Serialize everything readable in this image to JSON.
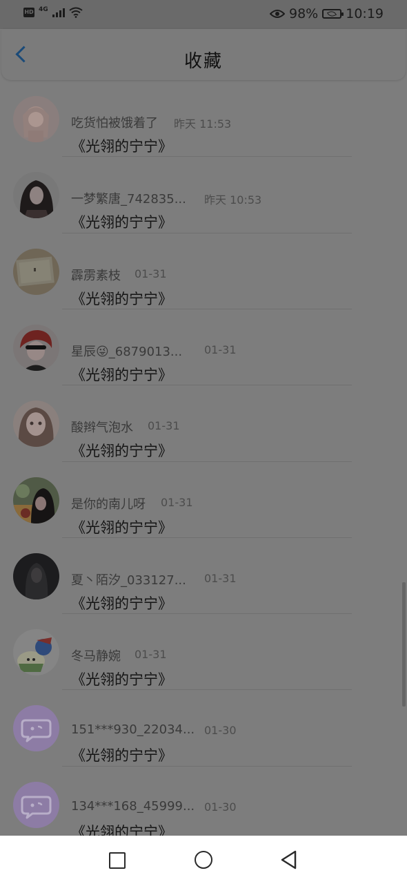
{
  "status": {
    "net": "4G",
    "battery": "98%",
    "time": "10:19"
  },
  "header": {
    "title": "收藏"
  },
  "items": [
    {
      "name": "吃货怕被饿着了",
      "time": "昨天 11:53",
      "content": "《光翎的宁宁》",
      "avatar": "girl-sketch"
    },
    {
      "name": "一梦繁唐_742835...",
      "time": "昨天 10:53",
      "content": "《光翎的宁宁》",
      "avatar": "dark-hair-girl"
    },
    {
      "name": "霹雳素枝",
      "time": "01-31",
      "content": "《光翎的宁宁》",
      "avatar": "book-photo"
    },
    {
      "name": "星辰😜_6879013...",
      "time": "01-31",
      "content": "《光翎的宁宁》",
      "avatar": "red-hair-boy"
    },
    {
      "name": "酸辫气泡水",
      "time": "01-31",
      "content": "《光翎的宁宁》",
      "avatar": "brown-hair-girl"
    },
    {
      "name": "是你的南儿呀",
      "time": "01-31",
      "content": "《光翎的宁宁》",
      "avatar": "photo-girl"
    },
    {
      "name": "夏丶陌汐_033127...",
      "time": "01-31",
      "content": "《光翎的宁宁》",
      "avatar": "dark-photo"
    },
    {
      "name": "冬马静婉",
      "time": "01-31",
      "content": "《光翎的宁宁》",
      "avatar": "cartoon-chick"
    },
    {
      "name": "151***930_22034...",
      "time": "01-30",
      "content": "《光翎的宁宁》",
      "avatar": "default-chat-icon"
    },
    {
      "name": "134***168_45999...",
      "time": "01-30",
      "content": "《光翎的宁宁》",
      "avatar": "default-chat-icon"
    }
  ],
  "colors": {
    "accent_back": "#1a4a78",
    "default_avatar": "#8d7ca5"
  }
}
